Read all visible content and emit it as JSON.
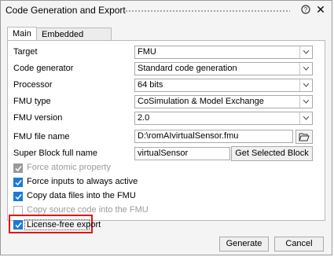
{
  "window": {
    "title": "Code Generation and Export"
  },
  "tabs": [
    {
      "label": "Main"
    },
    {
      "label": "Embedded Solver"
    }
  ],
  "fields": {
    "target": {
      "label": "Target",
      "value": "FMU"
    },
    "code_generator": {
      "label": "Code generator",
      "value": "Standard code generation"
    },
    "processor": {
      "label": "Processor",
      "value": "64 bits"
    },
    "fmu_type": {
      "label": "FMU type",
      "value": "CoSimulation & Model Exchange"
    },
    "fmu_version": {
      "label": "FMU version",
      "value": "2.0"
    },
    "fmu_file_name": {
      "label": "FMU file name",
      "value": "D:\\romAIvirtualSensor.fmu"
    },
    "super_block": {
      "label": "Super Block full name",
      "value": "virtualSensor",
      "button": "Get Selected Block"
    }
  },
  "checkboxes": [
    {
      "label": "Force atomic property",
      "checked": true,
      "disabled": true
    },
    {
      "label": "Force inputs to always active",
      "checked": true,
      "disabled": false
    },
    {
      "label": "Copy data files into the FMU",
      "checked": true,
      "disabled": false
    },
    {
      "label": "Copy source code into the FMU",
      "checked": false,
      "disabled": true
    },
    {
      "label": "License-free export",
      "checked": true,
      "disabled": false
    }
  ],
  "buttons": {
    "generate": "Generate",
    "cancel": "Cancel"
  },
  "colors": {
    "accent": "#1e7ad6",
    "highlight": "#e01616"
  }
}
